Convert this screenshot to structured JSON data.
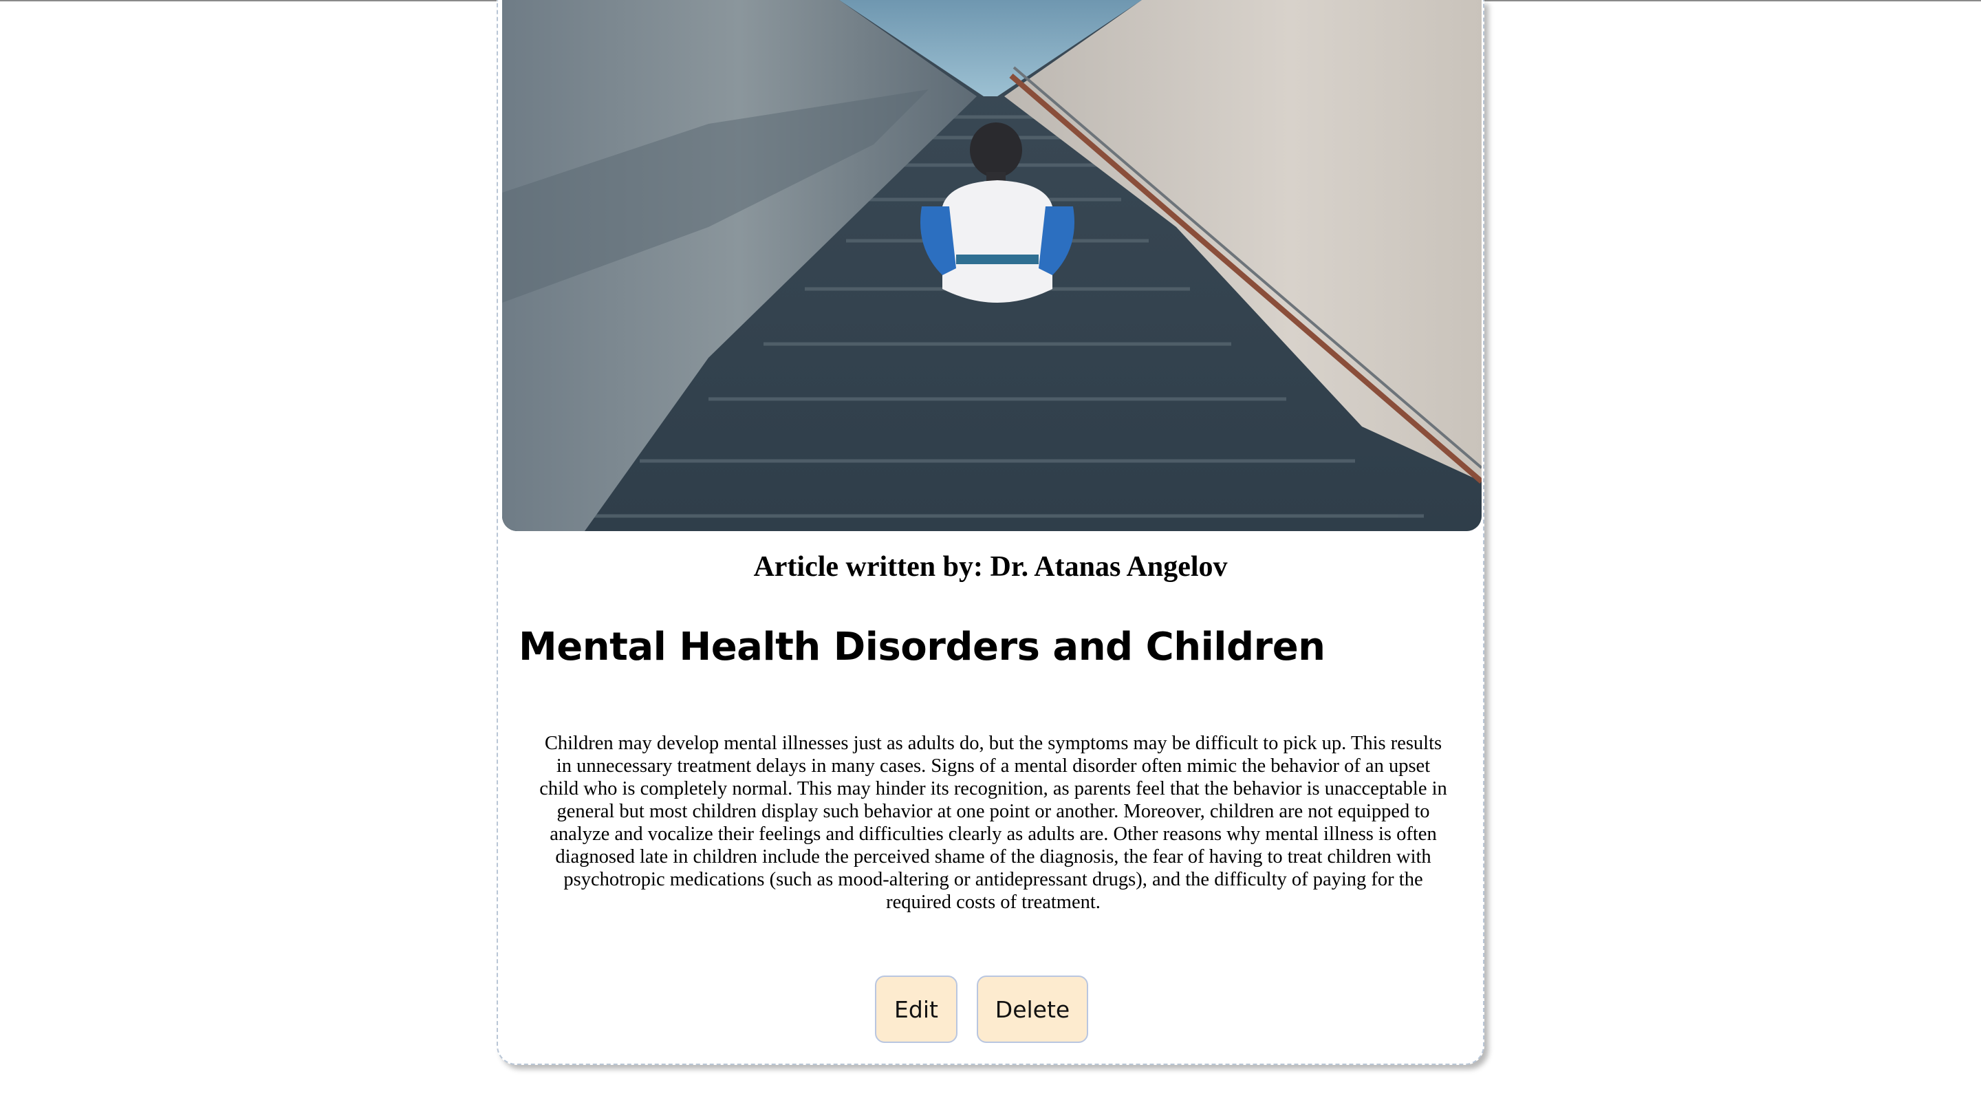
{
  "article": {
    "author_line": "Article written by: Dr. Atanas Angelov",
    "title": "Mental Health Disorders and Children",
    "body": "Children may develop mental illnesses just as adults do, but the symptoms may be difficult to pick up. This results in unnecessary treatment delays in many cases. Signs of a mental disorder often mimic the behavior of an upset child who is completely normal. This may hinder its recognition, as parents feel that the behavior is unacceptable in general but most children display such behavior at one point or another. Moreover, children are not equipped to analyze and vocalize their feelings and difficulties clearly as adults are. Other reasons why mental illness is often diagnosed late in children include the perceived shame of the diagnosis, the fear of having to treat children with psychotropic medications (such as mood-altering or antidepressant drugs), and the difficulty of paying for the required costs of treatment."
  },
  "actions": {
    "edit_label": "Edit",
    "delete_label": "Delete"
  },
  "colors": {
    "button_bg": "#fdebcf",
    "button_border": "#b9c6e0",
    "card_border": "#b9c6d6"
  }
}
